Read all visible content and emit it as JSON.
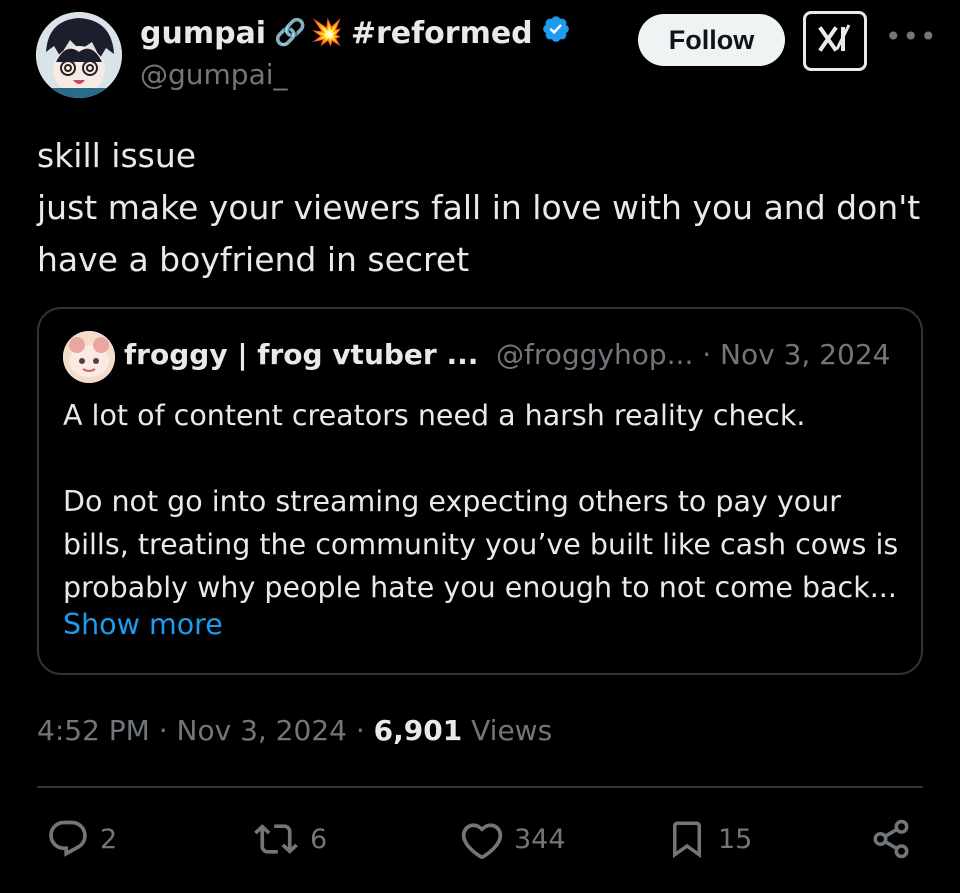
{
  "author": {
    "display_name": "gumpai",
    "name_emoji_1": "🔗",
    "name_emoji_2": "💥",
    "name_tag": "#reformed",
    "handle": "@gumpai_",
    "verified": true
  },
  "header": {
    "follow_label": "Follow",
    "more_label": "•••"
  },
  "tweet": {
    "text": "skill issue\njust make your viewers fall in love with you and don't\nhave a boyfriend in secret"
  },
  "quote": {
    "name": "froggy | frog vtuber ...",
    "meta": "@froggyhop... · Nov 3, 2024",
    "text": "A lot of content creators need a harsh reality check.\n\nDo not go into streaming expecting others to pay your\nbills, treating the community you’ve built like cash cows is\nprobably why people hate you enough to not come back...",
    "show_more": "Show more"
  },
  "meta": {
    "time_date": "4:52 PM · Nov 3, 2024 · ",
    "views_count": "6,901",
    "views_label": " Views"
  },
  "actions": {
    "replies": "2",
    "reposts": "6",
    "likes": "344",
    "bookmarks": "15"
  },
  "colors": {
    "background": "#000000",
    "text": "#e7e9ea",
    "secondary": "#71767b",
    "link": "#1d9bf0",
    "verified": "#1d9bf0",
    "border": "#2f3336"
  },
  "icons": [
    "link-icon",
    "explosion-icon",
    "verified-badge-icon",
    "grok-icon",
    "more-icon",
    "reply-icon",
    "repost-icon",
    "like-icon",
    "bookmark-icon",
    "share-icon"
  ]
}
